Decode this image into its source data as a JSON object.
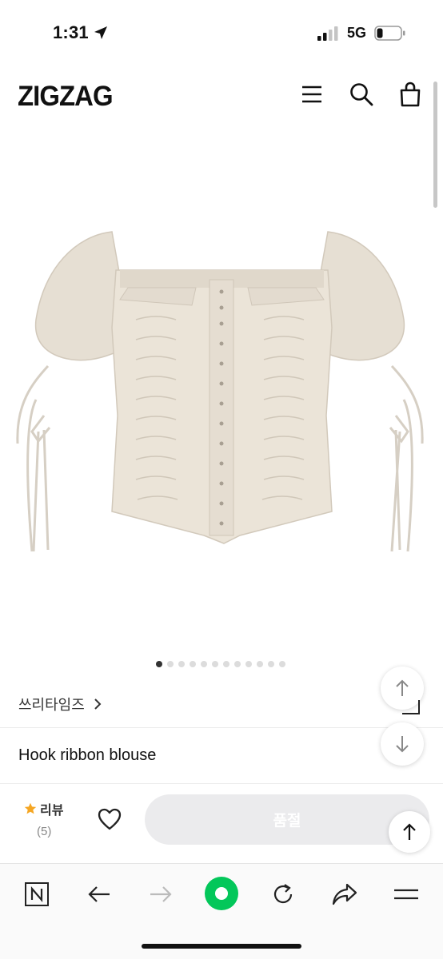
{
  "status_bar": {
    "time": "1:31",
    "network": "5G"
  },
  "header": {
    "logo": "ZIGZAG",
    "icons": [
      "menu-icon",
      "search-icon",
      "shopping-bag-icon"
    ]
  },
  "product": {
    "image_alt": "product-photo",
    "image_count": 12,
    "active_image_index": 0,
    "brand": "쓰리타임즈",
    "name": "Hook ribbon blouse"
  },
  "actions": {
    "review_label": "리뷰",
    "review_count": "(5)",
    "soldout_label": "품절"
  },
  "browser_toolbar": {
    "icons": [
      "naver-n-icon",
      "back-arrow-icon",
      "forward-arrow-icon",
      "green-dot-icon",
      "refresh-icon",
      "share-icon",
      "menu-lines-icon"
    ]
  },
  "colors": {
    "accent_star": "#f5a623",
    "green": "#03c75a",
    "soldout_bg": "#ebebed"
  }
}
